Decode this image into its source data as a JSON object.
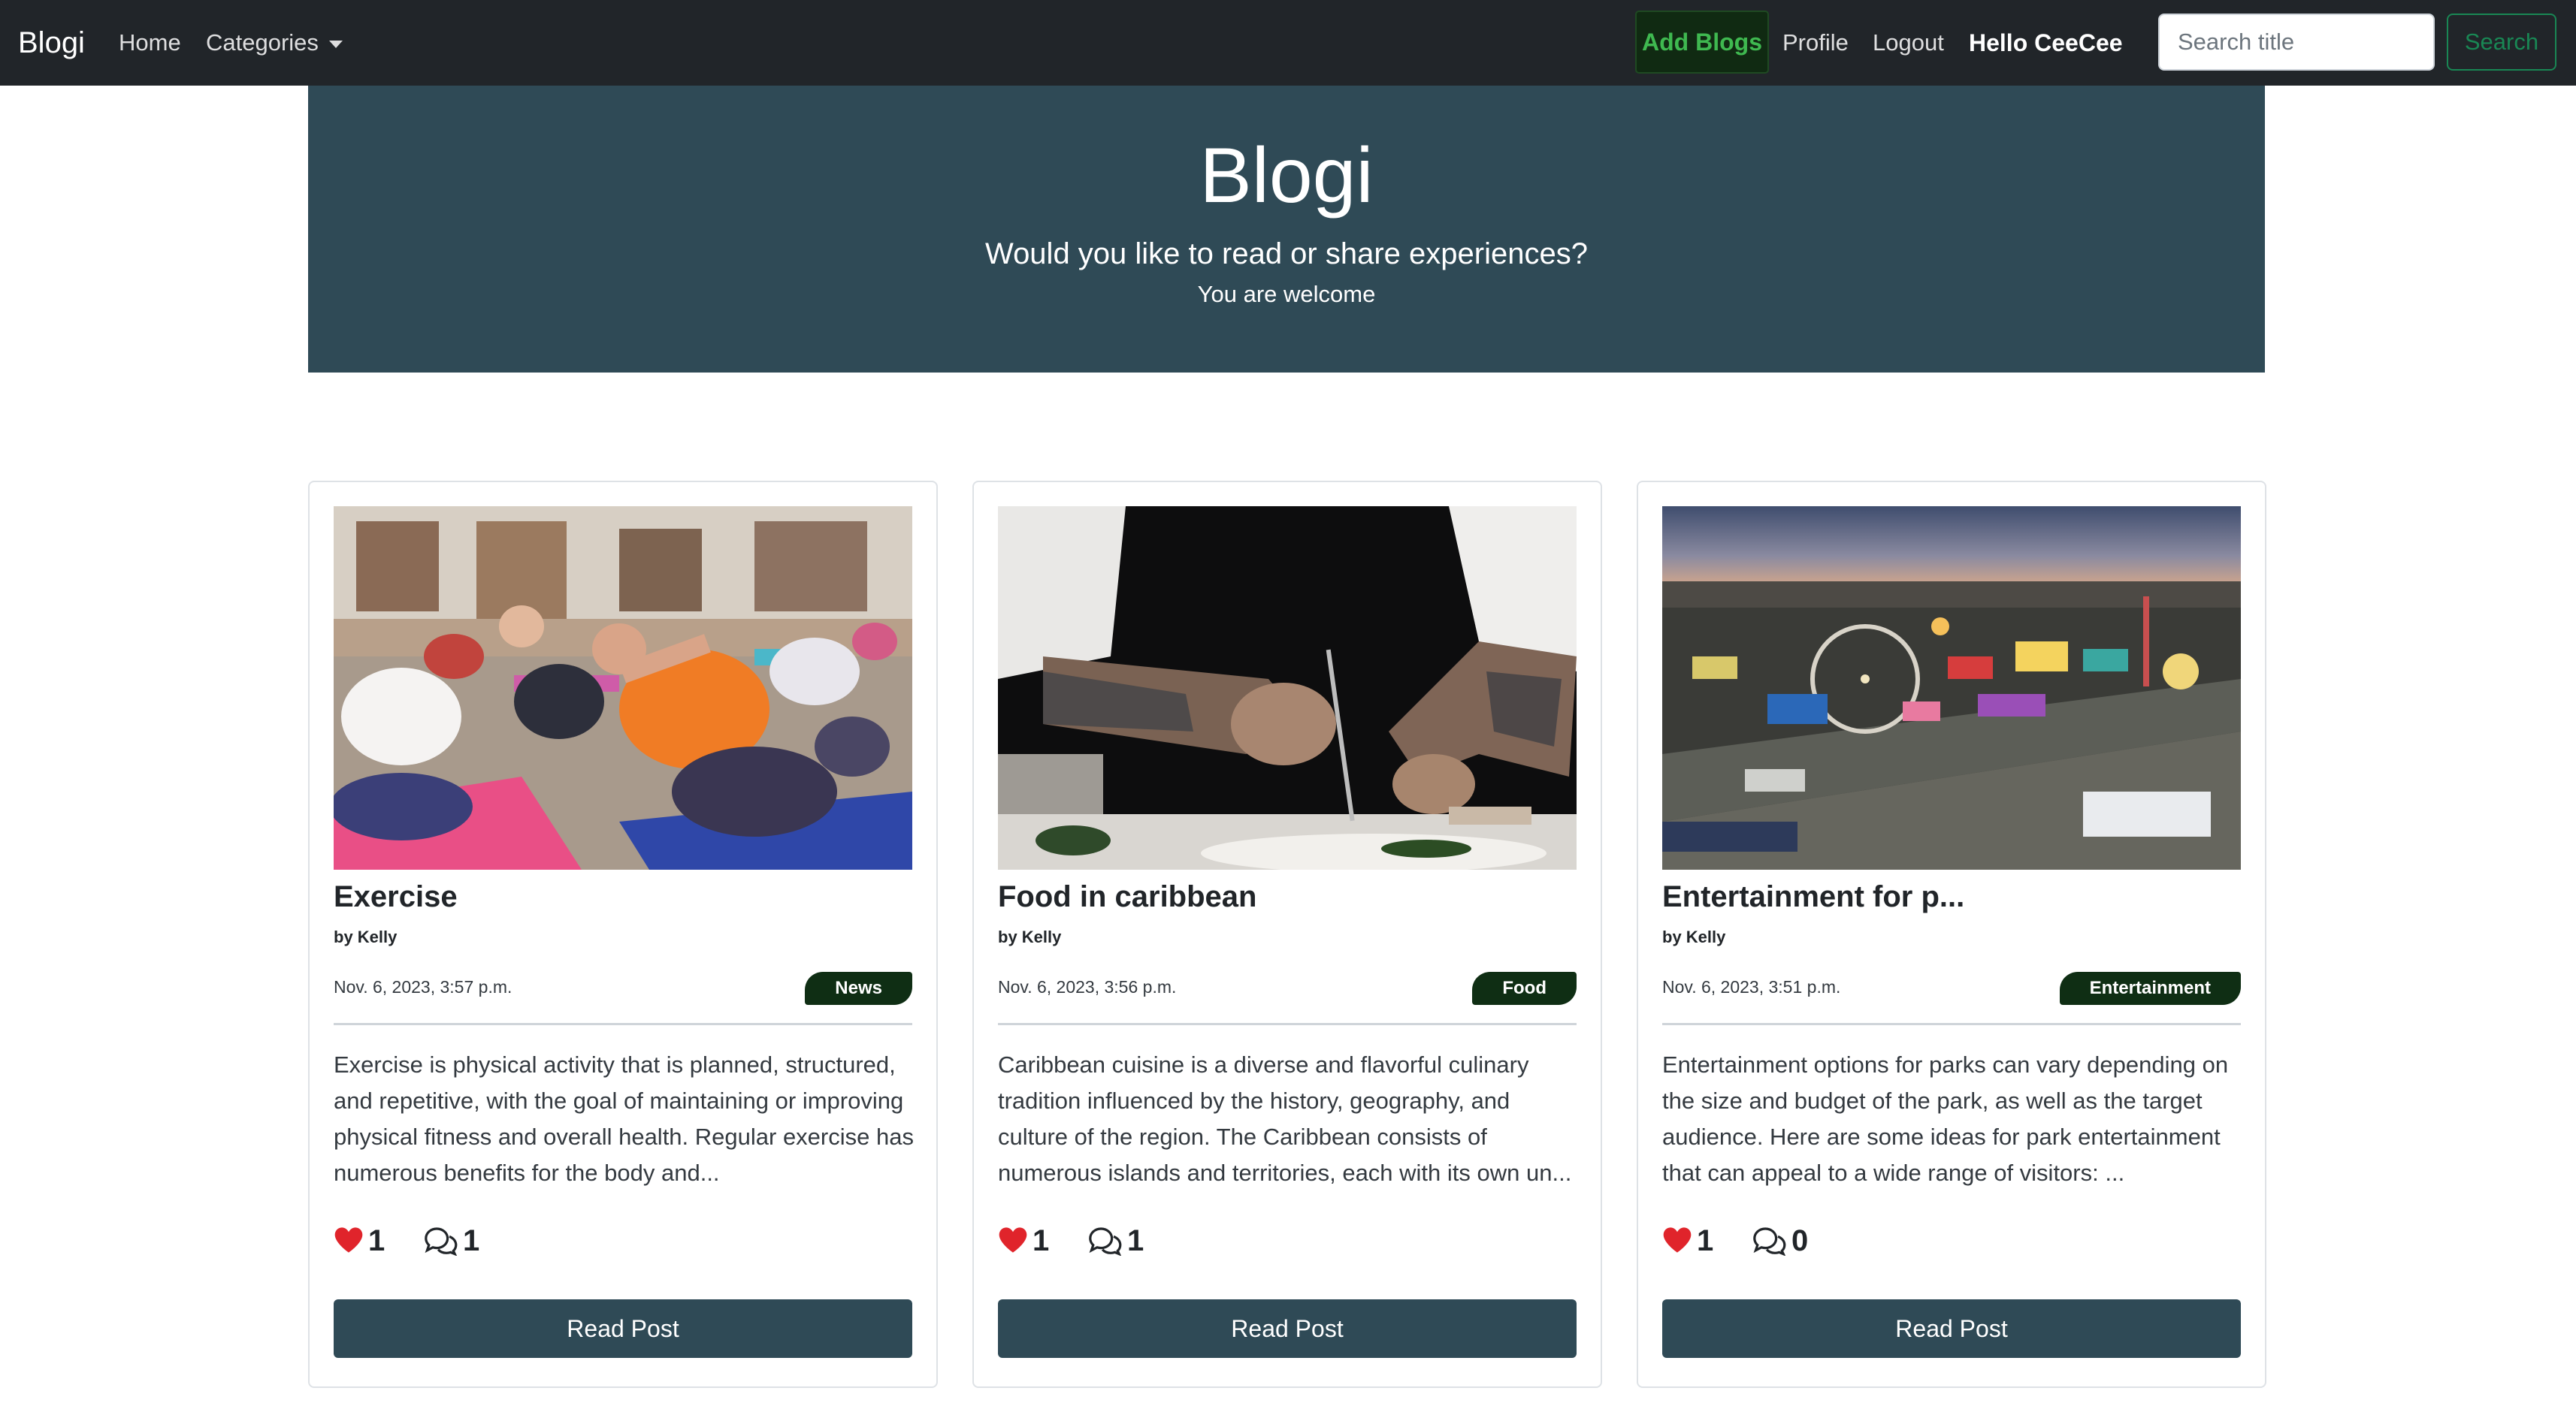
{
  "navbar": {
    "brand": "Blogi",
    "home": "Home",
    "categories": "Categories",
    "add_blogs": "Add Blogs",
    "profile": "Profile",
    "logout": "Logout",
    "greeting": "Hello CeeCee",
    "search_placeholder": "Search title",
    "search_button": "Search"
  },
  "hero": {
    "title": "Blogi",
    "subtitle": "Would you like to read or share experiences?",
    "tagline": "You are welcome"
  },
  "colors": {
    "navbar": "#212529",
    "hero": "#2f4a56",
    "badge": "#0f2e14",
    "like_heart": "#e0242b",
    "button": "#2f4a56"
  },
  "posts": [
    {
      "title": "Exercise",
      "author": "by Kelly",
      "date": "Nov. 6, 2023, 3:57 p.m.",
      "category": "News",
      "excerpt": "Exercise is physical activity that is planned, structured, and repetitive, with the goal of maintaining or improving physical fitness and overall health. Regular exercise has numerous benefits for the body and...",
      "likes": "1",
      "comments": "1",
      "button": "Read Post",
      "image": "yoga-class-photo"
    },
    {
      "title": "Food in caribbean",
      "author": "by Kelly",
      "date": "Nov. 6, 2023, 3:56 p.m.",
      "category": "Food",
      "excerpt": "Caribbean cuisine is a diverse and flavorful culinary tradition influenced by the history, geography, and culture of the region. The Caribbean consists of numerous islands and territories, each with its own un...",
      "likes": "1",
      "comments": "1",
      "button": "Read Post",
      "image": "chef-plating-photo"
    },
    {
      "title": "Entertainment for p...",
      "author": "by Kelly",
      "date": "Nov. 6, 2023, 3:51 p.m.",
      "category": "Entertainment",
      "excerpt": "Entertainment options for parks can vary depending on the size and budget of the park, as well as the target audience. Here are some ideas for park entertainment that can appeal to a wide range of visitors: ...",
      "likes": "1",
      "comments": "0",
      "button": "Read Post",
      "image": "amusement-park-aerial-photo"
    }
  ]
}
